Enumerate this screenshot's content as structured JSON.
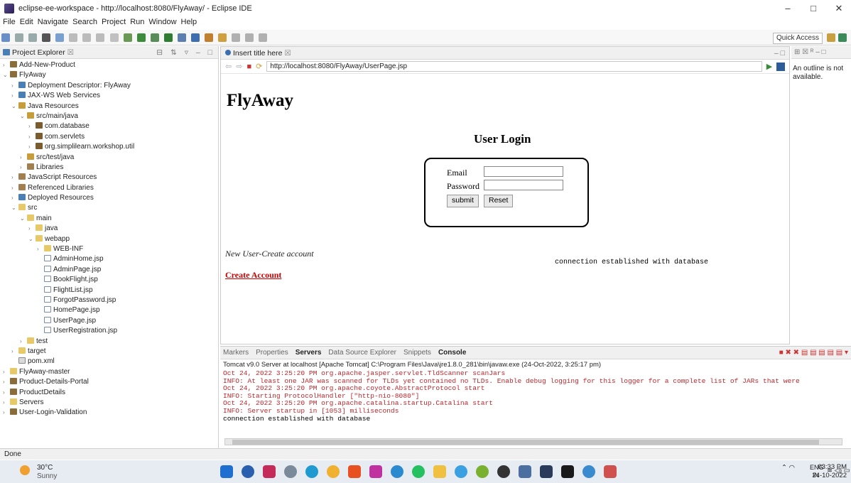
{
  "window": {
    "title": "eclipse-ee-workspace - http://localhost:8080/FlyAway/ - Eclipse IDE"
  },
  "menu": [
    "File",
    "Edit",
    "Navigate",
    "Search",
    "Project",
    "Run",
    "Window",
    "Help"
  ],
  "toolbar": {
    "quick_access": "Quick Access"
  },
  "project_explorer": {
    "title": "Project Explorer",
    "items": [
      {
        "depth": 0,
        "arrow": ">",
        "icon": "proj",
        "label": "Add-New-Product"
      },
      {
        "depth": 0,
        "arrow": "v",
        "icon": "proj",
        "label": "FlyAway"
      },
      {
        "depth": 1,
        "arrow": ">",
        "icon": "ws",
        "label": "Deployment Descriptor: FlyAway"
      },
      {
        "depth": 1,
        "arrow": ">",
        "icon": "ws",
        "label": "JAX-WS Web Services"
      },
      {
        "depth": 1,
        "arrow": "v",
        "icon": "src",
        "label": "Java Resources"
      },
      {
        "depth": 2,
        "arrow": "v",
        "icon": "src",
        "label": "src/main/java"
      },
      {
        "depth": 3,
        "arrow": ">",
        "icon": "pkg",
        "label": "com.database"
      },
      {
        "depth": 3,
        "arrow": ">",
        "icon": "pkg",
        "label": "com.servlets"
      },
      {
        "depth": 3,
        "arrow": ">",
        "icon": "pkg",
        "label": "org.simplilearn.workshop.util"
      },
      {
        "depth": 2,
        "arrow": ">",
        "icon": "src",
        "label": "src/test/java"
      },
      {
        "depth": 2,
        "arrow": ">",
        "icon": "lib",
        "label": "Libraries"
      },
      {
        "depth": 1,
        "arrow": ">",
        "icon": "lib",
        "label": "JavaScript Resources"
      },
      {
        "depth": 1,
        "arrow": ">",
        "icon": "lib",
        "label": "Referenced Libraries"
      },
      {
        "depth": 1,
        "arrow": ">",
        "icon": "ws",
        "label": "Deployed Resources"
      },
      {
        "depth": 1,
        "arrow": "v",
        "icon": "fold",
        "label": "src"
      },
      {
        "depth": 2,
        "arrow": "v",
        "icon": "fold",
        "label": "main"
      },
      {
        "depth": 3,
        "arrow": ">",
        "icon": "fold",
        "label": "java"
      },
      {
        "depth": 3,
        "arrow": "v",
        "icon": "fold",
        "label": "webapp"
      },
      {
        "depth": 4,
        "arrow": ">",
        "icon": "fold",
        "label": "WEB-INF"
      },
      {
        "depth": 4,
        "arrow": "",
        "icon": "file",
        "label": "AdminHome.jsp"
      },
      {
        "depth": 4,
        "arrow": "",
        "icon": "file",
        "label": "AdminPage.jsp"
      },
      {
        "depth": 4,
        "arrow": "",
        "icon": "file",
        "label": "BookFlight.jsp"
      },
      {
        "depth": 4,
        "arrow": "",
        "icon": "file",
        "label": "FlightList.jsp"
      },
      {
        "depth": 4,
        "arrow": "",
        "icon": "file",
        "label": "ForgotPassword.jsp"
      },
      {
        "depth": 4,
        "arrow": "",
        "icon": "file",
        "label": "HomePage.jsp"
      },
      {
        "depth": 4,
        "arrow": "",
        "icon": "file",
        "label": "UserPage.jsp"
      },
      {
        "depth": 4,
        "arrow": "",
        "icon": "file",
        "label": "UserRegistration.jsp"
      },
      {
        "depth": 2,
        "arrow": ">",
        "icon": "fold",
        "label": "test"
      },
      {
        "depth": 1,
        "arrow": ">",
        "icon": "fold",
        "label": "target"
      },
      {
        "depth": 1,
        "arrow": "",
        "icon": "xml",
        "label": "pom.xml"
      },
      {
        "depth": 0,
        "arrow": ">",
        "icon": "fold",
        "label": "FlyAway-master"
      },
      {
        "depth": 0,
        "arrow": ">",
        "icon": "proj",
        "label": "Product-Details-Portal"
      },
      {
        "depth": 0,
        "arrow": ">",
        "icon": "proj",
        "label": "ProductDetails"
      },
      {
        "depth": 0,
        "arrow": ">",
        "icon": "fold",
        "label": "Servers"
      },
      {
        "depth": 0,
        "arrow": ">",
        "icon": "proj",
        "label": "User-Login-Validation"
      }
    ]
  },
  "browser": {
    "tab_title": "Insert title here",
    "url": "http://localhost:8080/FlyAway/UserPage.jsp",
    "page": {
      "heading": "FlyAway",
      "subheading": "User Login",
      "email_label": "Email",
      "password_label": "Password",
      "submit_label": "submit",
      "reset_label": "Reset",
      "new_user_text": "New User-Create account",
      "connection_text": "connection established with database",
      "create_account_link": "Create Account"
    }
  },
  "outline": {
    "message": "An outline is not available."
  },
  "console": {
    "tabs": [
      "Markers",
      "Properties",
      "Servers",
      "Data Source Explorer",
      "Snippets",
      "Console"
    ],
    "header": "Tomcat v9.0 Server at localhost [Apache Tomcat] C:\\Program Files\\Java\\jre1.8.0_281\\bin\\javaw.exe (24-Oct-2022, 3:25:17 pm)",
    "lines": [
      {
        "text": "Oct 24, 2022 3:25:20 PM org.apache.jasper.servlet.TldScanner scanJars",
        "color": "red"
      },
      {
        "text": "INFO: At least one JAR was scanned for TLDs yet contained no TLDs. Enable debug logging for this logger for a complete list of JARs that were",
        "color": "red"
      },
      {
        "text": "Oct 24, 2022 3:25:20 PM org.apache.coyote.AbstractProtocol start",
        "color": "red"
      },
      {
        "text": "INFO: Starting ProtocolHandler [\"http-nio-8080\"]",
        "color": "red"
      },
      {
        "text": "Oct 24, 2022 3:25:20 PM org.apache.catalina.startup.Catalina start",
        "color": "red"
      },
      {
        "text": "INFO: Server startup in [1053] milliseconds",
        "color": "red"
      },
      {
        "text": "connection established with database",
        "color": "black"
      }
    ]
  },
  "status": {
    "text": "Done"
  },
  "taskbar": {
    "temperature": "30°C",
    "condition": "Sunny",
    "lang_top": "ENG",
    "lang_bottom": "IN",
    "time": "03:33 PM",
    "date": "24-10-2022"
  }
}
